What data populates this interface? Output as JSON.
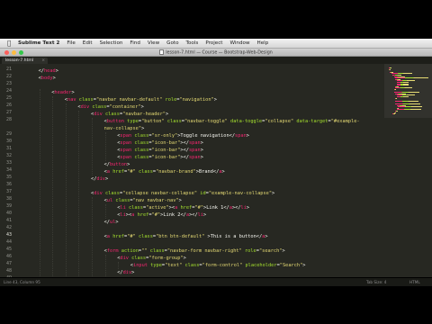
{
  "menubar": {
    "items": [
      {
        "label": "Sublime Text 2",
        "bold": true
      },
      {
        "label": "File"
      },
      {
        "label": "Edit"
      },
      {
        "label": "Selection"
      },
      {
        "label": "Find"
      },
      {
        "label": "View"
      },
      {
        "label": "Goto"
      },
      {
        "label": "Tools"
      },
      {
        "label": "Project"
      },
      {
        "label": "Window"
      },
      {
        "label": "Help"
      }
    ]
  },
  "window": {
    "title": "lesson-7.html — Course — Bootstrap-Web-Design"
  },
  "tabs": [
    {
      "label": "lesson-7.html"
    }
  ],
  "colors": {
    "background": "#272822",
    "tag": "#f92672",
    "attr": "#a6e22e",
    "string": "#e6db74",
    "text": "#f8f8f2",
    "line_number": "#8f908a"
  },
  "lines": [
    {
      "n": 21,
      "indent": 1,
      "tokens": [
        [
          "p",
          "</"
        ],
        [
          "t",
          "head"
        ],
        [
          "p",
          ">"
        ]
      ]
    },
    {
      "n": 22,
      "indent": 1,
      "tokens": [
        [
          "p",
          "<"
        ],
        [
          "t",
          "body"
        ],
        [
          "p",
          ">"
        ]
      ]
    },
    {
      "n": 23,
      "indent": 0,
      "tokens": []
    },
    {
      "n": 24,
      "indent": 2,
      "tokens": [
        [
          "p",
          "<"
        ],
        [
          "t",
          "header"
        ],
        [
          "p",
          ">"
        ]
      ]
    },
    {
      "n": 25,
      "indent": 3,
      "tokens": [
        [
          "p",
          "<"
        ],
        [
          "t",
          "nav"
        ],
        [
          "w",
          " "
        ],
        [
          "a",
          "class"
        ],
        [
          "p",
          "="
        ],
        [
          "s",
          "\"navbar navbar-default\""
        ],
        [
          "w",
          " "
        ],
        [
          "a",
          "role"
        ],
        [
          "p",
          "="
        ],
        [
          "s",
          "\"navigation\""
        ],
        [
          "p",
          ">"
        ]
      ]
    },
    {
      "n": 26,
      "indent": 4,
      "tokens": [
        [
          "p",
          "<"
        ],
        [
          "t",
          "div"
        ],
        [
          "w",
          " "
        ],
        [
          "a",
          "class"
        ],
        [
          "p",
          "="
        ],
        [
          "s",
          "\"container\""
        ],
        [
          "p",
          ">"
        ]
      ]
    },
    {
      "n": 27,
      "indent": 5,
      "tokens": [
        [
          "p",
          "<"
        ],
        [
          "t",
          "div"
        ],
        [
          "w",
          " "
        ],
        [
          "a",
          "class"
        ],
        [
          "p",
          "="
        ],
        [
          "s",
          "\"navbar-header\""
        ],
        [
          "p",
          ">"
        ]
      ]
    },
    {
      "n": 28,
      "indent": 6,
      "tokens": [
        [
          "p",
          "<"
        ],
        [
          "t",
          "button"
        ],
        [
          "w",
          " "
        ],
        [
          "a",
          "type"
        ],
        [
          "p",
          "="
        ],
        [
          "s",
          "\"button\""
        ],
        [
          "w",
          " "
        ],
        [
          "a",
          "class"
        ],
        [
          "p",
          "="
        ],
        [
          "s",
          "\"navbar-toggle\""
        ],
        [
          "w",
          " "
        ],
        [
          "a",
          "data-toggle"
        ],
        [
          "p",
          "="
        ],
        [
          "s",
          "\"collapse\""
        ],
        [
          "w",
          " "
        ],
        [
          "a",
          "data-target"
        ],
        [
          "p",
          "="
        ],
        [
          "s",
          "\"#example-"
        ]
      ]
    },
    {
      "n": null,
      "indent": 6,
      "tokens": [
        [
          "s",
          "nav-collapse\""
        ],
        [
          "p",
          ">"
        ]
      ]
    },
    {
      "n": 29,
      "indent": 7,
      "tokens": [
        [
          "p",
          "<"
        ],
        [
          "t",
          "span"
        ],
        [
          "w",
          " "
        ],
        [
          "a",
          "class"
        ],
        [
          "p",
          "="
        ],
        [
          "s",
          "\"sr-only\""
        ],
        [
          "p",
          ">"
        ],
        [
          "w",
          "Toggle navigation"
        ],
        [
          "p",
          "</"
        ],
        [
          "t",
          "span"
        ],
        [
          "p",
          ">"
        ]
      ]
    },
    {
      "n": 30,
      "indent": 7,
      "tokens": [
        [
          "p",
          "<"
        ],
        [
          "t",
          "span"
        ],
        [
          "w",
          " "
        ],
        [
          "a",
          "class"
        ],
        [
          "p",
          "="
        ],
        [
          "s",
          "\"icon-bar\""
        ],
        [
          "p",
          "></"
        ],
        [
          "t",
          "span"
        ],
        [
          "p",
          ">"
        ]
      ]
    },
    {
      "n": 31,
      "indent": 7,
      "tokens": [
        [
          "p",
          "<"
        ],
        [
          "t",
          "span"
        ],
        [
          "w",
          " "
        ],
        [
          "a",
          "class"
        ],
        [
          "p",
          "="
        ],
        [
          "s",
          "\"icon-bar\""
        ],
        [
          "p",
          "></"
        ],
        [
          "t",
          "span"
        ],
        [
          "p",
          ">"
        ]
      ]
    },
    {
      "n": 32,
      "indent": 7,
      "tokens": [
        [
          "p",
          "<"
        ],
        [
          "t",
          "span"
        ],
        [
          "w",
          " "
        ],
        [
          "a",
          "class"
        ],
        [
          "p",
          "="
        ],
        [
          "s",
          "\"icon-bar\""
        ],
        [
          "p",
          "></"
        ],
        [
          "t",
          "span"
        ],
        [
          "p",
          ">"
        ]
      ]
    },
    {
      "n": 33,
      "indent": 6,
      "tokens": [
        [
          "p",
          "</"
        ],
        [
          "t",
          "button"
        ],
        [
          "p",
          ">"
        ]
      ]
    },
    {
      "n": 34,
      "indent": 6,
      "tokens": [
        [
          "p",
          "<"
        ],
        [
          "t",
          "a"
        ],
        [
          "w",
          " "
        ],
        [
          "a",
          "href"
        ],
        [
          "p",
          "="
        ],
        [
          "s",
          "\"#\""
        ],
        [
          "w",
          " "
        ],
        [
          "a",
          "class"
        ],
        [
          "p",
          "="
        ],
        [
          "s",
          "\"navbar-brand\""
        ],
        [
          "p",
          ">"
        ],
        [
          "w",
          "Brand"
        ],
        [
          "p",
          "</"
        ],
        [
          "t",
          "a"
        ],
        [
          "p",
          ">"
        ]
      ]
    },
    {
      "n": 35,
      "indent": 5,
      "tokens": [
        [
          "p",
          "</"
        ],
        [
          "t",
          "div"
        ],
        [
          "p",
          ">"
        ]
      ]
    },
    {
      "n": 36,
      "indent": 0,
      "tokens": []
    },
    {
      "n": 37,
      "indent": 5,
      "tokens": [
        [
          "p",
          "<"
        ],
        [
          "t",
          "div"
        ],
        [
          "w",
          " "
        ],
        [
          "a",
          "class"
        ],
        [
          "p",
          "="
        ],
        [
          "s",
          "\"collapse navbar-collapse\""
        ],
        [
          "w",
          " "
        ],
        [
          "a",
          "id"
        ],
        [
          "p",
          "="
        ],
        [
          "s",
          "\"example-nav-collapse\""
        ],
        [
          "p",
          ">"
        ]
      ]
    },
    {
      "n": 38,
      "indent": 6,
      "tokens": [
        [
          "p",
          "<"
        ],
        [
          "t",
          "ul"
        ],
        [
          "w",
          " "
        ],
        [
          "a",
          "class"
        ],
        [
          "p",
          "="
        ],
        [
          "s",
          "\"nav navbar-nav\""
        ],
        [
          "p",
          ">"
        ]
      ]
    },
    {
      "n": 39,
      "indent": 7,
      "tokens": [
        [
          "p",
          "<"
        ],
        [
          "t",
          "li"
        ],
        [
          "w",
          " "
        ],
        [
          "a",
          "class"
        ],
        [
          "p",
          "="
        ],
        [
          "s",
          "\"active\""
        ],
        [
          "p",
          ">"
        ],
        [
          "p",
          "<"
        ],
        [
          "t",
          "a"
        ],
        [
          "w",
          " "
        ],
        [
          "a",
          "href"
        ],
        [
          "p",
          "="
        ],
        [
          "s",
          "\"#\""
        ],
        [
          "p",
          ">"
        ],
        [
          "w",
          "Link 1"
        ],
        [
          "p",
          "</"
        ],
        [
          "t",
          "a"
        ],
        [
          "p",
          "></"
        ],
        [
          "t",
          "li"
        ],
        [
          "p",
          ">"
        ]
      ]
    },
    {
      "n": 40,
      "indent": 7,
      "tokens": [
        [
          "p",
          "<"
        ],
        [
          "t",
          "li"
        ],
        [
          "p",
          "><"
        ],
        [
          "t",
          "a"
        ],
        [
          "w",
          " "
        ],
        [
          "a",
          "href"
        ],
        [
          "p",
          "="
        ],
        [
          "s",
          "\"#\""
        ],
        [
          "p",
          ">"
        ],
        [
          "w",
          "Link 2"
        ],
        [
          "p",
          "</"
        ],
        [
          "t",
          "a"
        ],
        [
          "p",
          "></"
        ],
        [
          "t",
          "li"
        ],
        [
          "p",
          ">"
        ]
      ]
    },
    {
      "n": 41,
      "indent": 6,
      "tokens": [
        [
          "p",
          "</"
        ],
        [
          "t",
          "ul"
        ],
        [
          "p",
          ">"
        ]
      ]
    },
    {
      "n": 42,
      "indent": 0,
      "tokens": []
    },
    {
      "n": 43,
      "indent": 6,
      "active": true,
      "tokens": [
        [
          "p",
          "<"
        ],
        [
          "t",
          "a"
        ],
        [
          "w",
          " "
        ],
        [
          "a",
          "href"
        ],
        [
          "p",
          "="
        ],
        [
          "s",
          "\"#\""
        ],
        [
          "w",
          " "
        ],
        [
          "a",
          "class"
        ],
        [
          "p",
          "="
        ],
        [
          "s",
          "\"btn btn-default\""
        ],
        [
          "w",
          " "
        ],
        [
          "p",
          ">"
        ],
        [
          "w",
          "This is a button"
        ],
        [
          "p",
          "</"
        ],
        [
          "t",
          "a"
        ],
        [
          "p",
          ">"
        ]
      ]
    },
    {
      "n": 44,
      "indent": 0,
      "tokens": []
    },
    {
      "n": 45,
      "indent": 6,
      "tokens": [
        [
          "p",
          "<"
        ],
        [
          "t",
          "form"
        ],
        [
          "w",
          " "
        ],
        [
          "a",
          "action"
        ],
        [
          "p",
          "="
        ],
        [
          "s",
          "\"\""
        ],
        [
          "w",
          " "
        ],
        [
          "a",
          "class"
        ],
        [
          "p",
          "="
        ],
        [
          "s",
          "\"navbar-form navbar-right\""
        ],
        [
          "w",
          " "
        ],
        [
          "a",
          "role"
        ],
        [
          "p",
          "="
        ],
        [
          "s",
          "\"search\""
        ],
        [
          "p",
          ">"
        ]
      ]
    },
    {
      "n": 46,
      "indent": 7,
      "tokens": [
        [
          "p",
          "<"
        ],
        [
          "t",
          "div"
        ],
        [
          "w",
          " "
        ],
        [
          "a",
          "class"
        ],
        [
          "p",
          "="
        ],
        [
          "s",
          "\"form-group\""
        ],
        [
          "p",
          ">"
        ]
      ]
    },
    {
      "n": 47,
      "indent": 8,
      "tokens": [
        [
          "p",
          "<"
        ],
        [
          "t",
          "input"
        ],
        [
          "w",
          " "
        ],
        [
          "a",
          "type"
        ],
        [
          "p",
          "="
        ],
        [
          "s",
          "\"text\""
        ],
        [
          "w",
          " "
        ],
        [
          "a",
          "class"
        ],
        [
          "p",
          "="
        ],
        [
          "s",
          "\"form-control\""
        ],
        [
          "w",
          " "
        ],
        [
          "a",
          "placeholder"
        ],
        [
          "p",
          "="
        ],
        [
          "s",
          "\"Search\""
        ],
        [
          "p",
          ">"
        ]
      ]
    },
    {
      "n": 48,
      "indent": 7,
      "tokens": [
        [
          "p",
          "</"
        ],
        [
          "t",
          "div"
        ],
        [
          "p",
          ">"
        ]
      ]
    },
    {
      "n": 49,
      "indent": 7,
      "tokens": [
        [
          "p",
          "<"
        ],
        [
          "t",
          "button"
        ],
        [
          "w",
          " "
        ],
        [
          "a",
          "type"
        ],
        [
          "p",
          "="
        ],
        [
          "s",
          "\"submit\""
        ],
        [
          "w",
          " "
        ],
        [
          "a",
          "class"
        ],
        [
          "p",
          "="
        ],
        [
          "s",
          "\"btn btn-default\""
        ],
        [
          "p",
          ">"
        ],
        [
          "w",
          "Submit"
        ],
        [
          "p",
          "</"
        ],
        [
          "t",
          "button"
        ],
        [
          "p",
          ">"
        ]
      ]
    },
    {
      "n": 50,
      "indent": 6,
      "tokens": [
        [
          "p",
          "</"
        ],
        [
          "t",
          "form"
        ],
        [
          "p",
          ">"
        ]
      ]
    },
    {
      "n": 51,
      "indent": 5,
      "tokens": [
        [
          "p",
          "</"
        ],
        [
          "t",
          "div"
        ],
        [
          "p",
          ">"
        ]
      ]
    },
    {
      "n": 52,
      "indent": 4,
      "tokens": [
        [
          "p",
          "</"
        ],
        [
          "t",
          "div"
        ],
        [
          "p",
          ">"
        ]
      ]
    }
  ],
  "statusbar": {
    "left": "Line 43, Column 95",
    "spacing": "Tab Size: 4",
    "syntax": "HTML"
  }
}
